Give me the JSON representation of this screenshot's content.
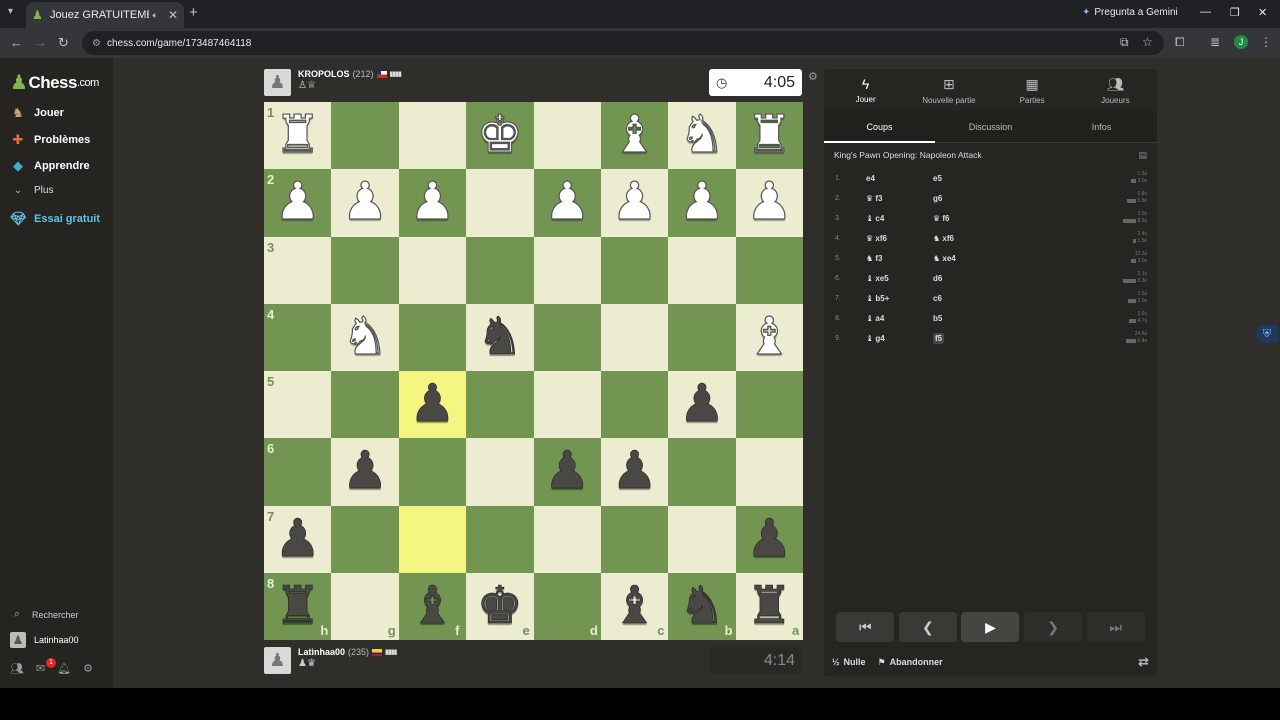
{
  "browser": {
    "tab_title": "Jouez GRATUITEMENT aux",
    "url": "chess.com/game/173487464118",
    "gemini": "Pregunta a Gemini",
    "profile_initial": "J"
  },
  "sidebar": {
    "logo_main": "Chess",
    "logo_domain": ".com",
    "items": [
      {
        "label": "Jouer",
        "icon": "play-icon"
      },
      {
        "label": "Problèmes",
        "icon": "puzzle-icon"
      },
      {
        "label": "Apprendre",
        "icon": "learn-icon"
      },
      {
        "label": "Plus",
        "icon": "chevron-down-icon"
      },
      {
        "label": "Essai gratuit",
        "icon": "diamond-icon"
      }
    ],
    "search": "Rechercher",
    "user": "Latinhaa00",
    "mail_badge": "1"
  },
  "top_player": {
    "name": "KROPOLOS",
    "rating": "(212)",
    "clock": "4:05",
    "flag_colors": [
      "#d52b1e",
      "#ffffff",
      "#0039a6"
    ]
  },
  "bottom_player": {
    "name": "Latinhaa00",
    "rating": "(235)",
    "clock": "4:14",
    "flag_colors": [
      "#fcd116",
      "#003893",
      "#ce1126"
    ]
  },
  "board": {
    "orientation": "black",
    "light_color": "#ebecd0",
    "dark_color": "#739552",
    "highlight_color": "#f5f682",
    "ranks": [
      "1",
      "2",
      "3",
      "4",
      "5",
      "6",
      "7",
      "8"
    ],
    "files": [
      "h",
      "g",
      "f",
      "e",
      "d",
      "c",
      "b",
      "a"
    ],
    "highlights": [
      [
        4,
        2
      ],
      [
        6,
        2
      ]
    ],
    "pieces": [
      {
        "r": 0,
        "c": 0,
        "p": "R",
        "color": "w"
      },
      {
        "r": 0,
        "c": 3,
        "p": "K",
        "color": "w"
      },
      {
        "r": 0,
        "c": 5,
        "p": "B",
        "color": "w"
      },
      {
        "r": 0,
        "c": 6,
        "p": "N",
        "color": "w"
      },
      {
        "r": 0,
        "c": 7,
        "p": "R",
        "color": "w"
      },
      {
        "r": 1,
        "c": 0,
        "p": "P",
        "color": "w"
      },
      {
        "r": 1,
        "c": 1,
        "p": "P",
        "color": "w"
      },
      {
        "r": 1,
        "c": 2,
        "p": "P",
        "color": "w"
      },
      {
        "r": 1,
        "c": 4,
        "p": "P",
        "color": "w"
      },
      {
        "r": 1,
        "c": 5,
        "p": "P",
        "color": "w"
      },
      {
        "r": 1,
        "c": 6,
        "p": "P",
        "color": "w"
      },
      {
        "r": 1,
        "c": 7,
        "p": "P",
        "color": "w"
      },
      {
        "r": 3,
        "c": 1,
        "p": "N",
        "color": "w"
      },
      {
        "r": 3,
        "c": 3,
        "p": "N",
        "color": "b"
      },
      {
        "r": 3,
        "c": 7,
        "p": "B",
        "color": "w"
      },
      {
        "r": 4,
        "c": 2,
        "p": "P",
        "color": "b"
      },
      {
        "r": 4,
        "c": 6,
        "p": "P",
        "color": "b"
      },
      {
        "r": 5,
        "c": 1,
        "p": "P",
        "color": "b"
      },
      {
        "r": 5,
        "c": 4,
        "p": "P",
        "color": "b"
      },
      {
        "r": 5,
        "c": 5,
        "p": "P",
        "color": "b"
      },
      {
        "r": 6,
        "c": 0,
        "p": "P",
        "color": "b"
      },
      {
        "r": 6,
        "c": 7,
        "p": "P",
        "color": "b"
      },
      {
        "r": 7,
        "c": 0,
        "p": "R",
        "color": "b"
      },
      {
        "r": 7,
        "c": 2,
        "p": "B",
        "color": "b"
      },
      {
        "r": 7,
        "c": 3,
        "p": "K",
        "color": "b"
      },
      {
        "r": 7,
        "c": 5,
        "p": "B",
        "color": "b"
      },
      {
        "r": 7,
        "c": 6,
        "p": "N",
        "color": "b"
      },
      {
        "r": 7,
        "c": 7,
        "p": "R",
        "color": "b"
      }
    ]
  },
  "panel": {
    "tabs": [
      {
        "label": "Jouer",
        "icon": "lightning-icon",
        "active": true
      },
      {
        "label": "Nouvelle partie",
        "icon": "plus-square-icon",
        "active": false
      },
      {
        "label": "Parties",
        "icon": "board-icon",
        "active": false
      },
      {
        "label": "Joueurs",
        "icon": "players-icon",
        "active": false
      }
    ],
    "subtabs": [
      "Coups",
      "Discussion",
      "Infos"
    ],
    "opening": "King's Pawn Opening: Napoleon Attack",
    "moves": [
      {
        "n": "1.",
        "wi": "",
        "w": "e4",
        "bi": "",
        "b": "e5",
        "tw": "1.3s",
        "tb": "3.0s",
        "ww": 2,
        "wb": 5
      },
      {
        "n": "2.",
        "wi": "♛",
        "w": "f3",
        "bi": "",
        "b": "g6",
        "tw": "0.8s",
        "tb": "5.8s",
        "ww": 1,
        "wb": 9
      },
      {
        "n": "3.",
        "wi": "♝",
        "w": "c4",
        "bi": "♛",
        "b": "f6",
        "tw": "3.0s",
        "tb": "8.3s",
        "ww": 5,
        "wb": 13
      },
      {
        "n": "4.",
        "wi": "♛",
        "w": "xf6",
        "bi": "♞",
        "b": "xf6",
        "tw": "2.4s",
        "tb": "1.5s",
        "ww": 4,
        "wb": 3
      },
      {
        "n": "5.",
        "wi": "♞",
        "w": "f3",
        "bi": "♞",
        "b": "xe4",
        "tw": "13.3s",
        "tb": "3.0s",
        "ww": 20,
        "wb": 5
      },
      {
        "n": "6.",
        "wi": "♝",
        "w": "xe5",
        "bi": "",
        "b": "d6",
        "tw": "2.1s",
        "tb": "8.3s",
        "ww": 4,
        "wb": 13
      },
      {
        "n": "7.",
        "wi": "♝",
        "w": "b5+",
        "bi": "",
        "b": "c6",
        "tw": "2.3s",
        "tb": "5.0s",
        "ww": 4,
        "wb": 8
      },
      {
        "n": "8.",
        "wi": "♝",
        "w": "a4",
        "bi": "",
        "b": "b5",
        "tw": "3.6s",
        "tb": "4.7s",
        "ww": 6,
        "wb": 7
      },
      {
        "n": "9.",
        "wi": "♝",
        "w": "g4",
        "bi": "",
        "b": "f5",
        "tw": "24.6s",
        "tb": "6.4s",
        "ww": 32,
        "wb": 10
      }
    ],
    "draw": "Nulle",
    "draw_prefix": "½",
    "resign": "Abandonner"
  }
}
